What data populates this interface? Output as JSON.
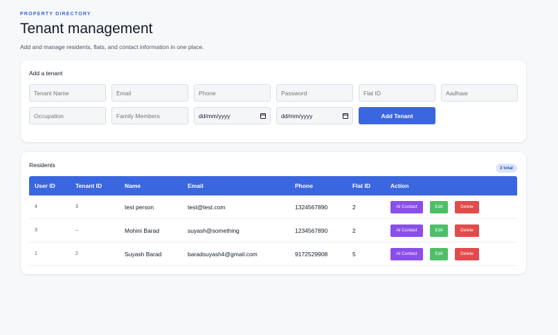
{
  "header": {
    "eyebrow": "PROPERTY DIRECTORY",
    "title": "Tenant management",
    "subtitle": "Add and manage residents, flats, and contact information in one place."
  },
  "form": {
    "title": "Add a tenant",
    "fields": {
      "tenant_name": "Tenant Name",
      "email": "Email",
      "phone": "Phone",
      "password": "Password",
      "flat_id": "Flat ID",
      "aadhaar": "Aadhaar",
      "occupation": "Occupation",
      "family_members": "Family Members",
      "date1": "dd/mm/yyyy",
      "date2": "dd/mm/yyyy"
    },
    "submit_label": "Add Tenant"
  },
  "residents": {
    "title": "Residents",
    "total_badge": "3 total",
    "columns": [
      "User ID",
      "Tenant ID",
      "Name",
      "Email",
      "Phone",
      "Flat ID",
      "Action"
    ],
    "rows": [
      {
        "user_id": "4",
        "tenant_id": "3",
        "name": "test person",
        "email": "test@test.com",
        "phone": "1324567890",
        "flat_id": "2"
      },
      {
        "user_id": "3",
        "tenant_id": "–",
        "name": "Mohini Barad",
        "email": "suyash@something",
        "phone": "1234567890",
        "flat_id": "2"
      },
      {
        "user_id": "1",
        "tenant_id": "2",
        "name": "Suyash Barad",
        "email": "baradsuyash4@gmail.com",
        "phone": "9172529908",
        "flat_id": "5"
      }
    ],
    "actions": {
      "ai": "AI Contact",
      "edit": "Edit",
      "delete": "Delete"
    }
  },
  "colors": {
    "accent": "#3a66df",
    "ai_button": "#8a4fe8",
    "edit_button": "#4fbf67",
    "delete_button": "#e14b4b"
  }
}
